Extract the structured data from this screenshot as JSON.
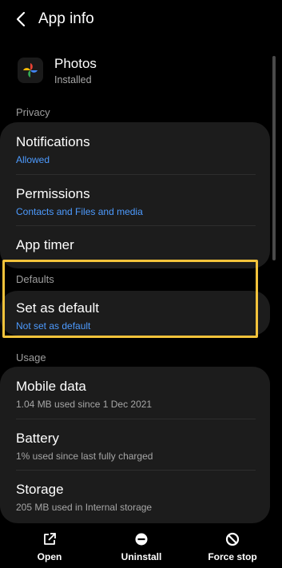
{
  "header": {
    "title": "App info"
  },
  "app": {
    "name": "Photos",
    "status": "Installed"
  },
  "sections": {
    "privacy": "Privacy",
    "defaults": "Defaults",
    "usage": "Usage"
  },
  "privacy_items": [
    {
      "title": "Notifications",
      "subtitle": "Allowed"
    },
    {
      "title": "Permissions",
      "subtitle": "Contacts and Files and media"
    },
    {
      "title": "App timer"
    }
  ],
  "defaults_items": [
    {
      "title": "Set as default",
      "subtitle": "Not set as default"
    }
  ],
  "usage_items": [
    {
      "title": "Mobile data",
      "subtitle": "1.04 MB used since 1 Dec 2021"
    },
    {
      "title": "Battery",
      "subtitle": "1% used since last fully charged"
    },
    {
      "title": "Storage",
      "subtitle": "205 MB used in Internal storage"
    }
  ],
  "actions": [
    {
      "label": "Open",
      "icon": "open-external-icon"
    },
    {
      "label": "Uninstall",
      "icon": "uninstall-icon"
    },
    {
      "label": "Force stop",
      "icon": "force-stop-icon"
    }
  ],
  "colors": {
    "accent": "#4d9bff",
    "highlight": "#f3c33b",
    "card": "#1c1c1c"
  }
}
